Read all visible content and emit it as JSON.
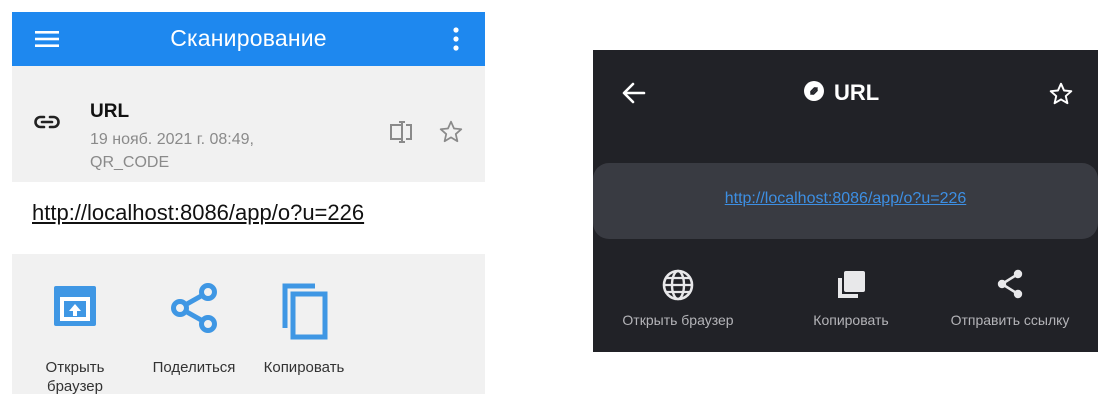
{
  "left_app": {
    "toolbar": {
      "title": "Сканирование",
      "menu_icon": "menu-icon",
      "more_icon": "more-vert-icon",
      "color": "#1e88ef"
    },
    "header": {
      "type": "URL",
      "date": "19 нояб. 2021 г. 08:49,",
      "format": "QR_CODE",
      "icons": [
        "link-icon",
        "rename-icon",
        "star-outline-icon"
      ]
    },
    "content": {
      "url": "http://localhost:8086/app/o?u=226"
    },
    "actions": [
      {
        "label": "Открыть браузер",
        "icon": "open-browser-icon"
      },
      {
        "label": "Поделиться",
        "icon": "share-icon"
      },
      {
        "label": "Копировать",
        "icon": "copy-icon"
      }
    ],
    "accent": "#3f97e4"
  },
  "right_app": {
    "topbar": {
      "title": "URL",
      "back_icon": "arrow-back-icon",
      "title_icon": "link-badge-icon",
      "star_icon": "star-outline-icon"
    },
    "content": {
      "url": "http://localhost:8086/app/o?u=226"
    },
    "actions": [
      {
        "label": "Открыть браузер",
        "icon": "globe-icon"
      },
      {
        "label": "Копировать",
        "icon": "copy-icon"
      },
      {
        "label": "Отправить ссылку",
        "icon": "share-icon"
      }
    ],
    "background": "#212227",
    "link_color": "#3d8fe3"
  }
}
